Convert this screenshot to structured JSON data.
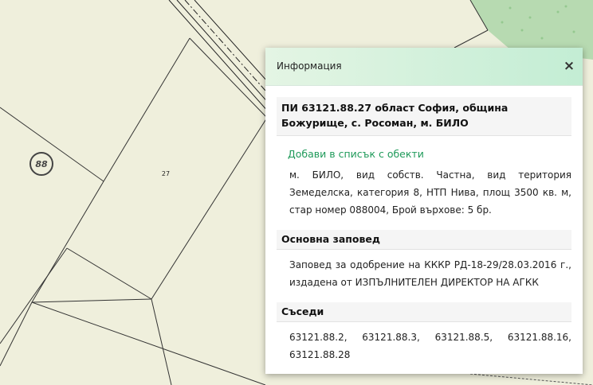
{
  "map": {
    "parcel_number_label": "27",
    "cadastral_zone_label": "88"
  },
  "colors": {
    "map_background": "#efefdc",
    "forest": "#b7dab1",
    "link": "#1f9a5a"
  },
  "panel": {
    "title": "Информация",
    "close_label": "×",
    "parcel_title": "ПИ 63121.88.27 област София, община Божурище, с. Росоман, м. БИЛО",
    "add_link": "Добави в списък с обекти",
    "description": "м. БИЛО, вид собств. Частна, вид територия Земеделска, категория 8, НТП Нива, площ 3500 кв. м, стар номер 088004, Брой върхове: 5 бр.",
    "order_heading": "Основна заповед",
    "order_text": "Заповед за одобрение на КККР РД-18-29/28.03.2016 г., издадена от ИЗПЪЛНИТЕЛЕН ДИРЕКТОР НА АГКК",
    "neighbours_heading": "Съседи",
    "neighbours": [
      "63121.88.2,",
      "63121.88.3,",
      "63121.88.5,",
      "63121.88.16,",
      "63121.88.28"
    ]
  }
}
